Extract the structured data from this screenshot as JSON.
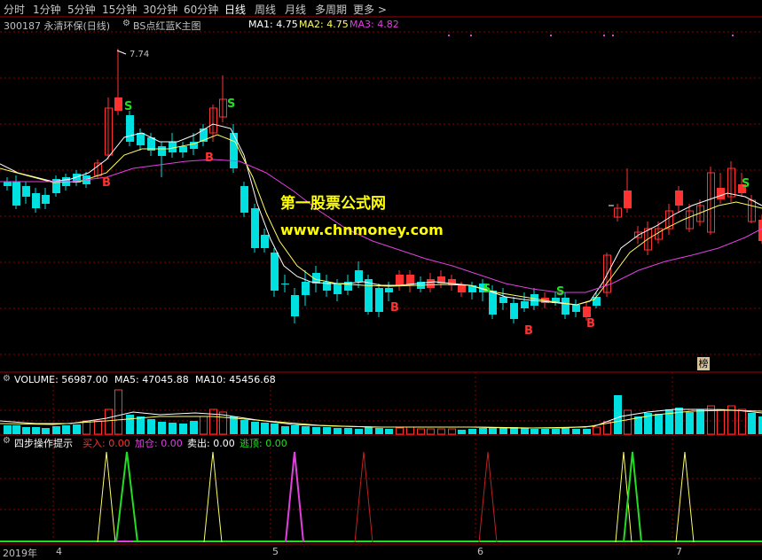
{
  "tabs": [
    "分时",
    "1分钟",
    "5分钟",
    "15分钟",
    "30分钟",
    "60分钟",
    "日线",
    "周线",
    "月线",
    "多周期",
    "更多 >"
  ],
  "active_tab": "日线",
  "stock": {
    "code_name": "300187 永清环保(日线)",
    "indicator": "BS点红蓝K主图"
  },
  "ma": {
    "ma1": "MA1: 4.75",
    "ma2": "MA2: 4.75",
    "ma3": "MA3: 4.82"
  },
  "price_high_label": "7.74",
  "watermark": {
    "line1": "第一股票公式网",
    "line2": "www.chnmoney.com"
  },
  "badge": "榜",
  "volume": {
    "title": "VOLUME: 56987.00",
    "ma5": "MA5: 47045.88",
    "ma10": "MA10: 45456.68"
  },
  "sub": {
    "title": "四步操作提示",
    "buy": "买入: 0.00",
    "add": "加仓: 0.00",
    "sell": "卖出: 0.00",
    "escape": "逃顶: 0.00"
  },
  "signals": {
    "b": "B",
    "s": "S"
  },
  "x_axis": {
    "year": "2019年",
    "m4": "4",
    "m5": "5",
    "m6": "6",
    "m7": "7"
  },
  "colors": {
    "up": "#ff3232",
    "down": "#00e0e0",
    "ma_white": "#ffffff",
    "ma_yellow": "#ffff66",
    "ma_purple": "#e040e0",
    "green": "#22dd22",
    "dashed": "#8b0000"
  }
}
